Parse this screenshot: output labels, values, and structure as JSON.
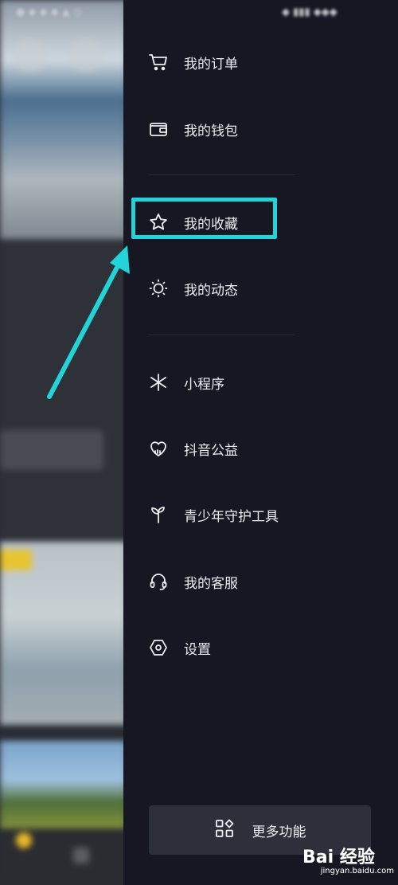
{
  "drawer": {
    "items": [
      {
        "label": "我的订单",
        "icon": "cart-icon"
      },
      {
        "label": "我的钱包",
        "icon": "wallet-icon"
      },
      {
        "label": "我的收藏",
        "icon": "star-icon"
      },
      {
        "label": "我的动态",
        "icon": "activity-icon"
      },
      {
        "label": "小程序",
        "icon": "mini-program-icon"
      },
      {
        "label": "抖音公益",
        "icon": "charity-heart-icon"
      },
      {
        "label": "青少年守护工具",
        "icon": "sprout-icon"
      },
      {
        "label": "我的客服",
        "icon": "headset-icon"
      },
      {
        "label": "设置",
        "icon": "settings-hexagon-icon"
      }
    ],
    "more_button": {
      "label": "更多功能",
      "icon": "grid-icon"
    }
  },
  "annotation": {
    "highlight_color": "#22d3d8",
    "highlighted_item": "我的收藏"
  },
  "watermark": {
    "main": "Bai 经验",
    "sub": "jingyan.baidu.com"
  },
  "colors": {
    "drawer_bg": "#161722",
    "text": "#eceef2",
    "accent": "#22d3d8"
  }
}
